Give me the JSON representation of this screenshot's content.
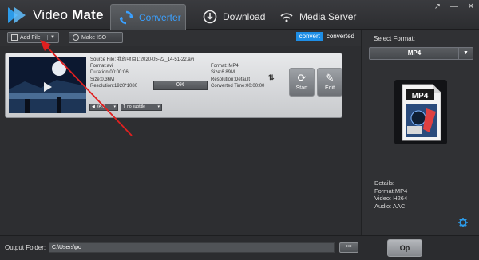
{
  "app": {
    "brand_light": "Video ",
    "brand_bold": "Mate"
  },
  "tabs": [
    {
      "label": "Converter",
      "icon": "refresh-icon",
      "active": true
    },
    {
      "label": "Download",
      "icon": "download-icon",
      "active": false
    },
    {
      "label": "Media Server",
      "icon": "wifi-icon",
      "active": false
    }
  ],
  "window_controls": [
    "↗",
    "—",
    "✕"
  ],
  "toolbar": {
    "add_file_label": "Add File",
    "make_iso_label": "Make ISO",
    "convert_label": "convert",
    "converted_label": "converted"
  },
  "file_item": {
    "source_file": "Source File: 我的项目1:2020-05-22_14-51-22.avi",
    "src_format": "Format:avi",
    "src_duration": "Duration:00:00:06",
    "src_size": "Size:0.36M",
    "src_resolution": "Resolution:1920*1080",
    "progress_text": "0%",
    "progress": 0,
    "out_format": "Format: MP4",
    "out_size": "Size:6.89M",
    "out_resolution": "Resolution:Default",
    "out_converted_time": "Converted Time:00:00:00",
    "start_label": "Start",
    "edit_label": "Edit",
    "audio_track": "#A:0",
    "subtitle": "no subtitle"
  },
  "right_panel": {
    "select_format_label": "Select Format:",
    "format_value": "MP4",
    "preview_text": "MP4",
    "details": [
      "Details:",
      "Format:MP4",
      "Video: H264",
      "Audio: AAC"
    ]
  },
  "bottom": {
    "output_folder_label": "Output Folder:",
    "output_path": "C:\\Users\\pc",
    "browse_label": "•••",
    "open_label": "Op"
  },
  "colors": {
    "accent": "#1e8ee6",
    "annotation_arrow": "#e02020"
  }
}
